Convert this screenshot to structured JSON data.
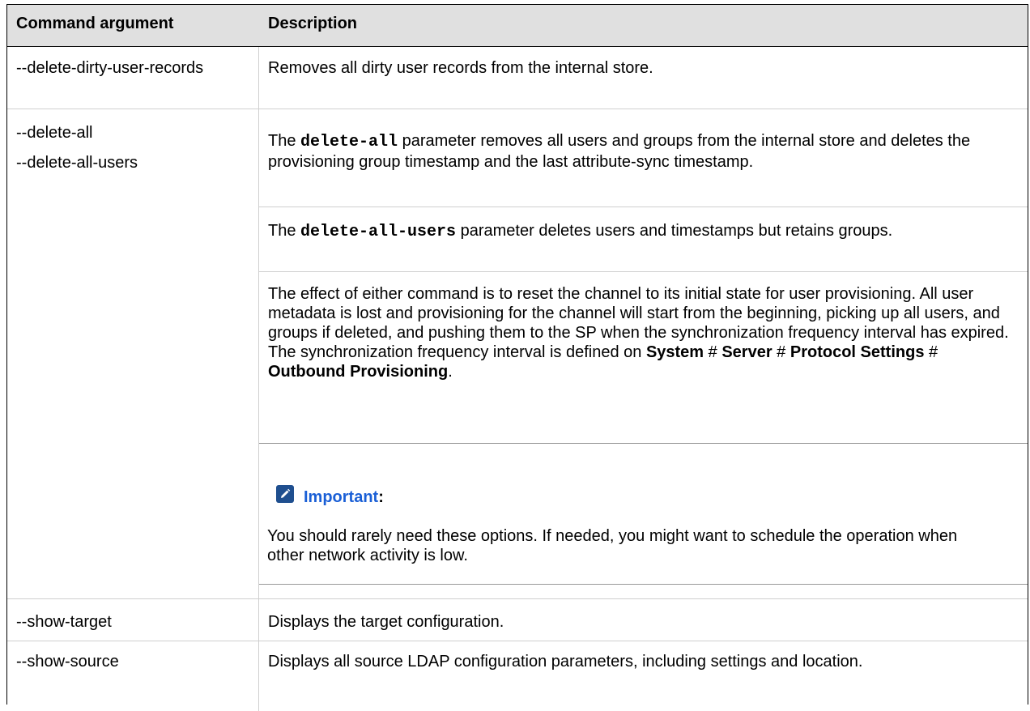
{
  "table": {
    "headers": [
      "Command argument",
      "Description"
    ],
    "rows": [
      {
        "args": [
          "--delete-dirty-user-records"
        ],
        "desc": "Removes all dirty user records from the internal store."
      },
      {
        "args": [
          "--delete-all",
          "--delete-all-users"
        ],
        "p1": {
          "pre": "The ",
          "code": "delete-all",
          "post": " parameter removes all users and groups from the internal store and deletes the provisioning group timestamp and the last attribute-sync timestamp."
        },
        "p2": {
          "pre": "The ",
          "code": "delete-all-users",
          "post": " parameter deletes users and timestamps but retains groups."
        },
        "p3": {
          "text": "The effect of either command is to reset the channel to its initial state for user provisioning. All user metadata is lost and provisioning for the channel will start from the beginning, picking up all users, and groups if deleted, and pushing them to the SP when the synchronization frequency interval has expired. The synchronization frequency interval is defined on ",
          "path1": "System",
          "sep1": " # ",
          "path2": "Server",
          "sep2": " # ",
          "path3": "Protocol Settings",
          "sep3": " # ",
          "path4": "Outbound Provisioning",
          "end": "."
        },
        "note": {
          "title": "Important",
          "colon": ":",
          "body": "You should rarely need these options. If needed, you might want to schedule the operation when other network activity is low."
        }
      },
      {
        "args": [
          "--show-target"
        ],
        "desc": "Displays the target configuration."
      },
      {
        "args": [
          "--show-source"
        ],
        "desc": "Displays all source LDAP configuration parameters, including settings and location."
      }
    ]
  }
}
